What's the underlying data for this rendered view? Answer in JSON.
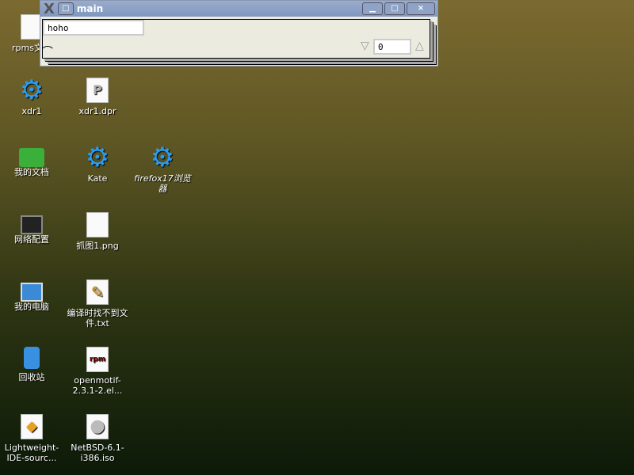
{
  "window": {
    "title": "main",
    "text_value": "hoho",
    "spin_value": "0"
  },
  "icons": [
    {
      "label": "rpms文件",
      "type": "doc"
    },
    {
      "label": "xdr1",
      "type": "gear"
    },
    {
      "label": "xdr1.dpr",
      "type": "doc"
    },
    {
      "label": "我的文档",
      "type": "folder"
    },
    {
      "label": "Kate",
      "type": "gear"
    },
    {
      "label": "firefox17浏览器",
      "type": "gear"
    },
    {
      "label": "网络配置",
      "type": "monitor"
    },
    {
      "label": "抓图1.png",
      "type": "image"
    },
    {
      "label": "我的电脑",
      "type": "computer"
    },
    {
      "label": "编译时找不到文件.txt",
      "type": "text"
    },
    {
      "label": "回收站",
      "type": "trash"
    },
    {
      "label": "openmotif-2.3.1-2.el...",
      "type": "rpm"
    },
    {
      "label": "Lightweight-IDE-sourc...",
      "type": "package"
    },
    {
      "label": "NetBSD-6.1-i386.iso",
      "type": "disc"
    }
  ]
}
